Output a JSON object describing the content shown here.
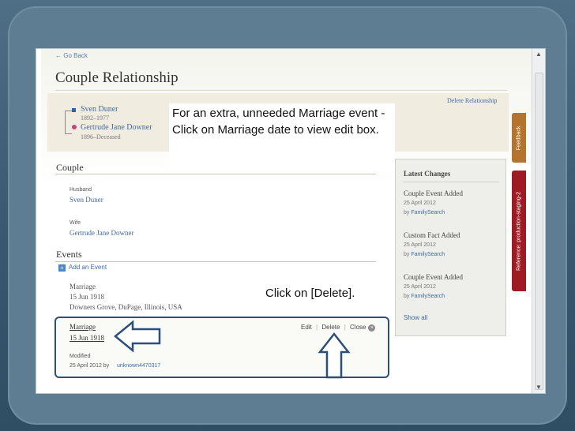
{
  "page": {
    "back_link": "← Go Back",
    "title": "Couple Relationship",
    "delete_relationship": "Delete Relationship"
  },
  "couple": {
    "husband": {
      "name": "Sven Duner",
      "dates": "1892–1977"
    },
    "wife": {
      "name": "Gertrude Jane Downer",
      "dates": "1896–Deceased"
    }
  },
  "sections": {
    "couple_heading": "Couple",
    "husband_label": "Husband",
    "husband_value": "Sven Duner",
    "wife_label": "Wife",
    "wife_value": "Gertrude Jane Downer",
    "events_heading": "Events",
    "add_event": "Add an Event"
  },
  "events": {
    "first": {
      "type": "Marriage",
      "date": "15 Jun 1918",
      "place": "Downers Grove, DuPage, Illinois, USA"
    },
    "editing": {
      "type": "Marriage",
      "date": "15 Jun 1918",
      "modified_label": "Modified",
      "modified_date": "25 April 2012 by",
      "modified_by": "unknown4470317",
      "actions": {
        "edit": "Edit",
        "delete": "Delete",
        "close": "Close",
        "sep": "|"
      }
    }
  },
  "latest_changes": {
    "title": "Latest Changes",
    "items": [
      {
        "title": "Couple Event Added",
        "date": "25 April 2012",
        "by_label": "by",
        "by": "FamilySearch"
      },
      {
        "title": "Custom Fact Added",
        "date": "25 April 2012",
        "by_label": "by",
        "by": "FamilySearch"
      },
      {
        "title": "Couple Event Added",
        "date": "25 April 2012",
        "by_label": "by",
        "by": "FamilySearch"
      }
    ],
    "show_all": "Show all"
  },
  "tabs": {
    "feedback": "Feedback",
    "reference": "Reference: production-staging-2"
  },
  "annotations": {
    "top_note": "For an extra, unneeded Marriage event - Click on Marriage date to view edit box.",
    "delete_note": "Click on [Delete]."
  },
  "colors": {
    "link": "#3e6aa3",
    "annotation_border": "#2c4f7a",
    "feedback_tab": "#b5742e",
    "reference_tab": "#9e1b24"
  }
}
